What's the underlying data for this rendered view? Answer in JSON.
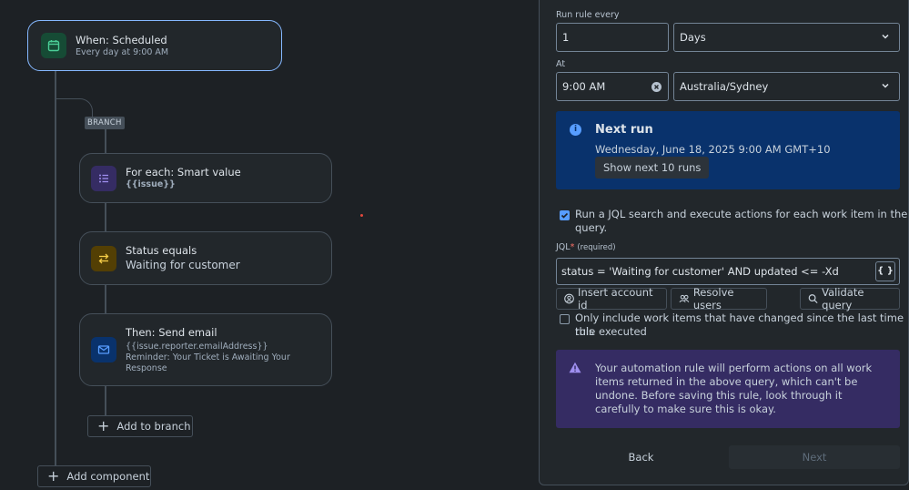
{
  "trigger": {
    "title": "When: Scheduled",
    "subtitle": "Every day at 9:00 AM",
    "icon": "calendar-icon"
  },
  "branch": {
    "label": "BRANCH"
  },
  "foreach": {
    "title": "For each: Smart value",
    "subtitle": "{{issue}}",
    "icon": "list-icon"
  },
  "condition": {
    "title": "Status equals",
    "subtitle": "Waiting for customer",
    "icon": "swap-icon"
  },
  "action": {
    "title": "Then: Send email",
    "line1": "{{issue.reporter.emailAddress}}",
    "line2": "Reminder: Your Ticket is Awaiting Your",
    "line3": "Response",
    "icon": "mail-icon"
  },
  "add_to_branch": "Add to branch",
  "add_component": "Add component",
  "panel": {
    "run_every_label": "Run rule every",
    "run_every_value": "1",
    "run_every_unit": "Days",
    "at_label": "At",
    "at_value": "9:00 AM",
    "timezone": "Australia/Sydney",
    "next_run": {
      "heading": "Next run",
      "date": "Wednesday, June 18, 2025 9:00 AM GMT+10",
      "button": "Show next 10 runs"
    },
    "jql_checkbox": {
      "line1": "Run a JQL search and execute actions for each work item in the",
      "line2": "query.",
      "checked": true
    },
    "jql_label": "JQL",
    "jql_required": "(required)",
    "jql_asterisk": "*",
    "jql_value": "status = 'Waiting for customer' AND updated <= -Xd",
    "jql_brace": "{ }",
    "buttons": {
      "insert": "Insert account id",
      "resolve": "Resolve users",
      "validate": "Validate query"
    },
    "changed_checkbox": {
      "line1": "Only include work items that have changed since the last time this",
      "line2": "rule executed",
      "checked": false
    },
    "warning": "Your automation rule will perform actions on all work items returned in the above query, which can't be undone. Before saving this rule, look through it carefully to make sure this is okay.",
    "back": "Back",
    "next": "Next"
  },
  "colors": {
    "info_bg": "#09326c",
    "warning_bg": "#352c63",
    "accent": "#579dff",
    "selected_border": "#85b8ff"
  }
}
